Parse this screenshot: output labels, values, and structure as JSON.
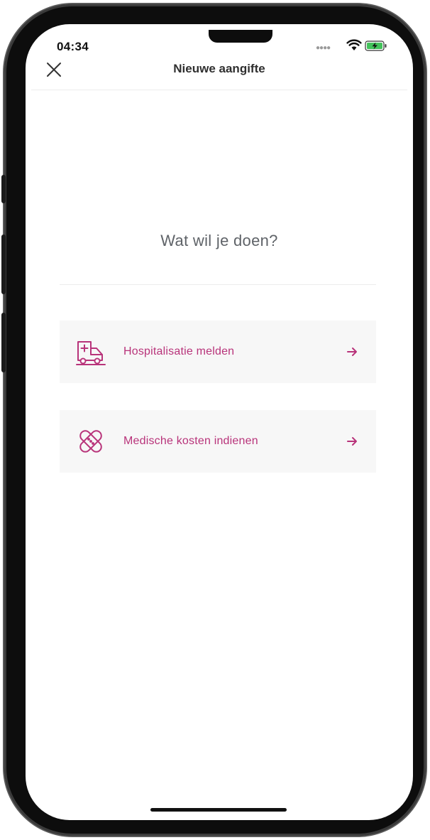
{
  "status_bar": {
    "time": "04:34"
  },
  "nav": {
    "title": "Nieuwe aangifte"
  },
  "content": {
    "question": "Wat wil je doen?",
    "options": [
      {
        "label": "Hospitalisatie melden",
        "icon": "ambulance-icon"
      },
      {
        "label": "Medische kosten indienen",
        "icon": "bandage-icon"
      }
    ]
  },
  "colors": {
    "accent": "#b8337a",
    "option_bg": "#f7f7f7",
    "question_text": "#5f6368"
  }
}
